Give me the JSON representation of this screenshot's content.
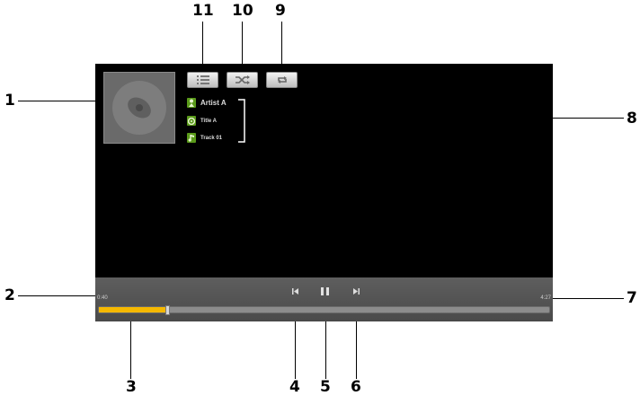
{
  "callouts": {
    "c1": "1",
    "c2": "2",
    "c3": "3",
    "c4": "4",
    "c5": "5",
    "c6": "6",
    "c7": "7",
    "c8": "8",
    "c9": "9",
    "c10": "10",
    "c11": "11"
  },
  "player": {
    "artist": "Artist A",
    "title": "Title A",
    "track": "Track 01",
    "elapsed_time": "0:40",
    "total_time": "4:27",
    "progress_fraction": 0.15
  },
  "colors": {
    "progress_fill": "#f5b800",
    "meta_icon": "#5a9a1a",
    "screen_bg": "#000000"
  },
  "icons": {
    "toolbar": [
      "playlist-icon",
      "shuffle-icon",
      "repeat-icon"
    ],
    "meta": [
      "artist-icon",
      "album-icon",
      "track-icon"
    ],
    "controls": [
      "previous-icon",
      "pause-icon",
      "next-icon"
    ]
  }
}
